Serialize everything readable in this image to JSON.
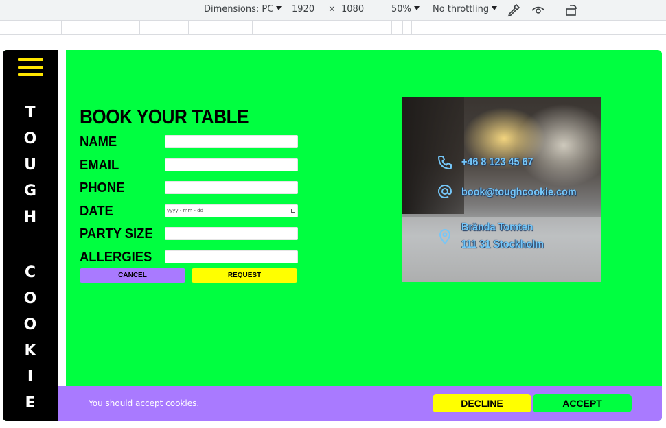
{
  "devtools": {
    "dimensions_label": "Dimensions: PC",
    "width": "1920",
    "times": "×",
    "height": "1080",
    "zoom": "50%",
    "throttling": "No throttling"
  },
  "site": {
    "brand_letters": [
      "T",
      "O",
      "U",
      "G",
      "H",
      "",
      "C",
      "O",
      "O",
      "K",
      "I",
      "E"
    ],
    "form": {
      "title": "BOOK YOUR TABLE",
      "fields": [
        {
          "label": "NAME",
          "value": ""
        },
        {
          "label": "EMAIL",
          "value": ""
        },
        {
          "label": "PHONE",
          "value": ""
        },
        {
          "label": "DATE",
          "value": "yyyy - mm - dd"
        },
        {
          "label": "PARTY SIZE",
          "value": ""
        },
        {
          "label": "ALLERGIES",
          "value": ""
        }
      ],
      "cancel_label": "CANCEL",
      "request_label": "REQUEST"
    },
    "contact": {
      "phone": "+46 8 123 45 67",
      "email": "book@toughcookie.com",
      "address_line1": "Brända Tomten",
      "address_line2": "111 31 Stockholm"
    },
    "cookie_bar": {
      "message": "You should accept cookies.",
      "decline_label": "DECLINE",
      "accept_label": "ACCEPT"
    }
  },
  "colors": {
    "page_bg": "#00ff40",
    "sidebar_bg": "#000000",
    "burger": "#ffe600",
    "cancel_btn": "#a97aff",
    "request_btn": "#ffff00",
    "cookie_bar": "#a97aff",
    "decline_btn": "#ffff00",
    "accept_btn": "#00ff40",
    "contact_text": "#6dc8ff"
  },
  "icons": [
    "caret-down-icon",
    "eyedropper-icon",
    "eye-icon",
    "rotate-device-icon",
    "hamburger-menu-icon",
    "phone-icon",
    "at-sign-icon",
    "map-pin-icon"
  ]
}
